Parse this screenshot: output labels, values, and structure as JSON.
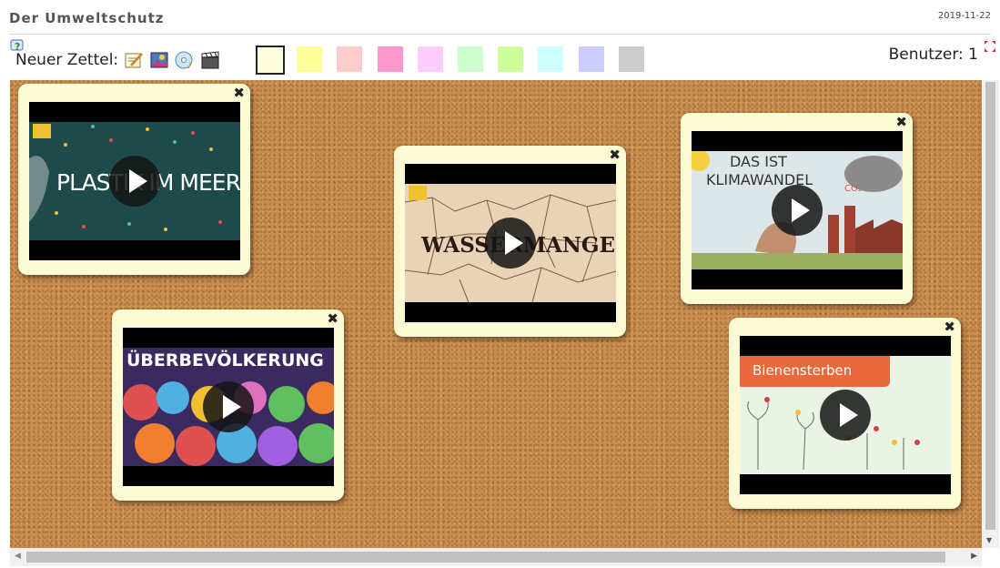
{
  "header": {
    "title": "Der Umweltschutz",
    "date": "2019-11-22"
  },
  "toolbar": {
    "new_note_label": "Neuer Zettel:",
    "users_label": "Benutzer: 1",
    "swatches": [
      "#fffde0",
      "#ffff99",
      "#ffcccc",
      "#ff99cc",
      "#ffccff",
      "#ccffcc",
      "#ccff99",
      "#ccffff",
      "#ccccff",
      "#cccccc"
    ]
  },
  "notes": [
    {
      "thumb_text": "PLASTIK IM MEER"
    },
    {
      "thumb_text": "WASSERMANGEL"
    },
    {
      "thumb_text_line1": "DAS IST",
      "thumb_text_line2": "KLIMAWANDEL"
    },
    {
      "thumb_text": "ÜBERBEVÖLKERUNG"
    },
    {
      "thumb_text": "Bienensterben"
    }
  ],
  "close_glyph": "✖"
}
